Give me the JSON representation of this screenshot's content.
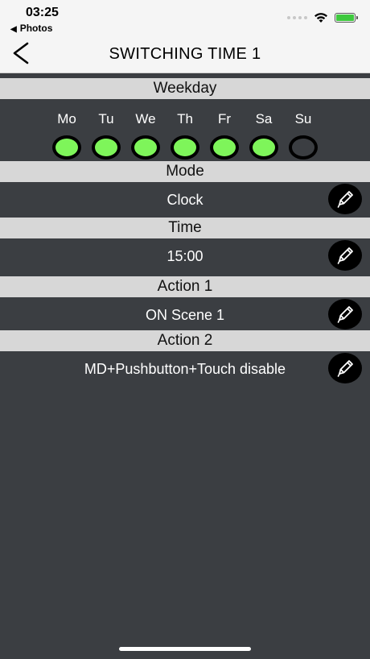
{
  "status_bar": {
    "time": "03:25",
    "back_app": "Photos",
    "battery_color": "#3ec93e"
  },
  "navbar": {
    "back_icon": "chevron-left-icon",
    "title": "SWITCHING TIME 1"
  },
  "weekday": {
    "header": "Weekday",
    "days": [
      {
        "label": "Mo",
        "active": true
      },
      {
        "label": "Tu",
        "active": true
      },
      {
        "label": "We",
        "active": true
      },
      {
        "label": "Th",
        "active": true
      },
      {
        "label": "Fr",
        "active": true
      },
      {
        "label": "Sa",
        "active": true
      },
      {
        "label": "Su",
        "active": false
      }
    ],
    "active_color": "#7ef55a",
    "inactive_color": "#3b3e42"
  },
  "mode": {
    "header": "Mode",
    "value": "Clock",
    "edit_icon": "pencil-icon"
  },
  "time": {
    "header": "Time",
    "value": "15:00",
    "edit_icon": "pencil-icon"
  },
  "action1": {
    "header": "Action 1",
    "value": "ON Scene 1",
    "edit_icon": "pencil-icon"
  },
  "action2": {
    "header": "Action 2",
    "value": "MD+Pushbutton+Touch disable",
    "edit_icon": "pencil-icon"
  },
  "colors": {
    "background": "#3b3e42",
    "header_bar": "#d7d7d7",
    "nav_bar": "#f5f5f5"
  }
}
